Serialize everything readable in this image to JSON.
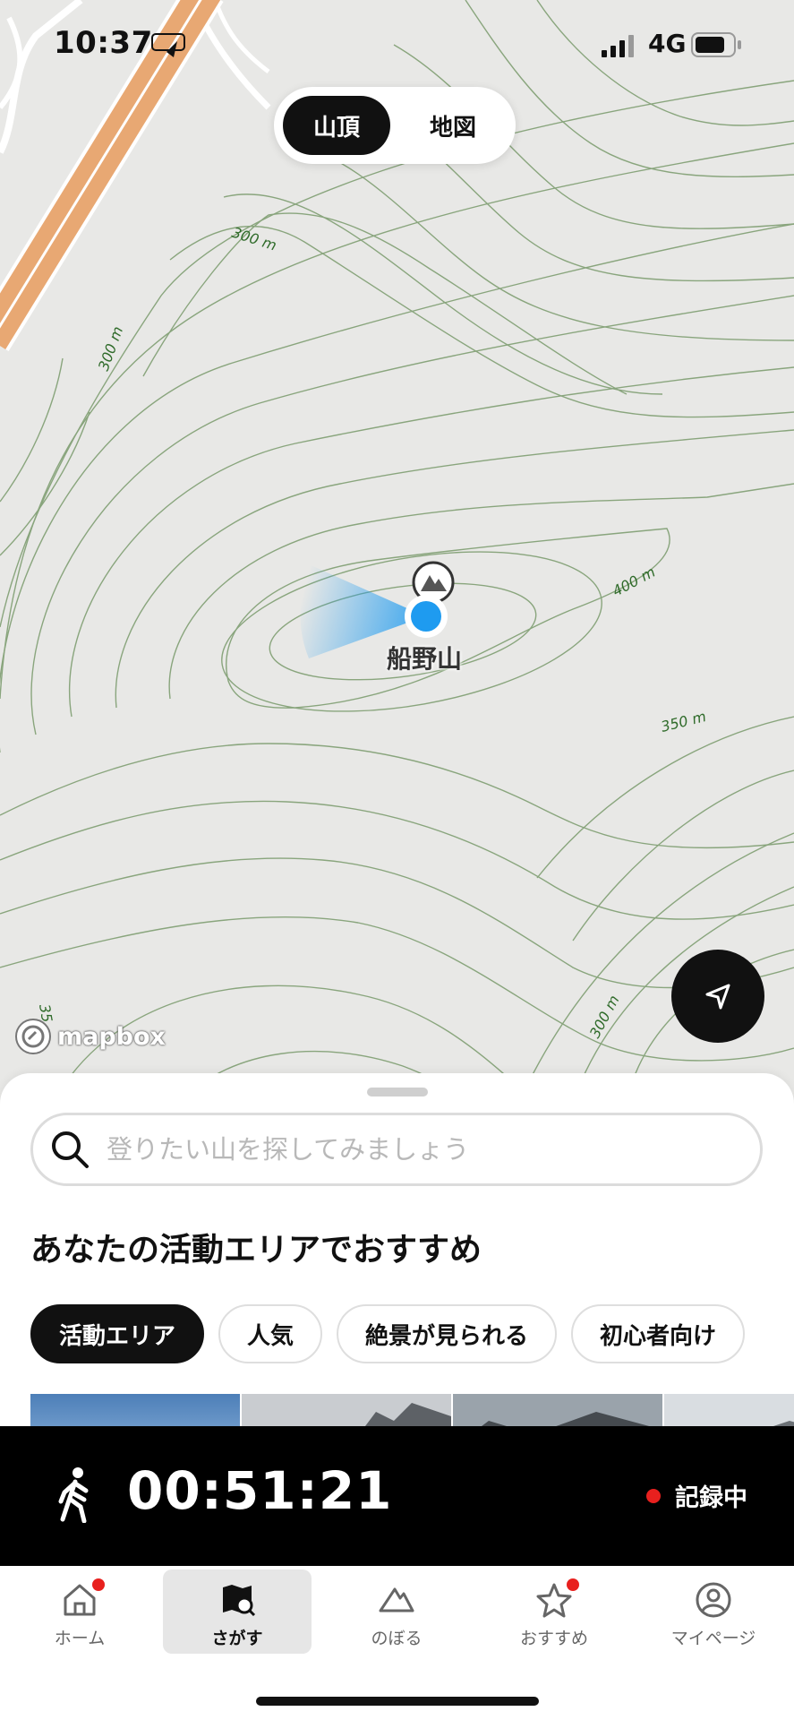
{
  "status_bar": {
    "time": "10:37",
    "network": "4G"
  },
  "map": {
    "segment": {
      "option_a": "山頂",
      "option_b": "地図",
      "selected": "山頂"
    },
    "contour_labels": [
      "300 m",
      "300 m",
      "400 m",
      "350 m",
      "300 m",
      "35"
    ],
    "mountain_name": "船野山",
    "attribution": "mapbox"
  },
  "sheet": {
    "search_placeholder": "登りたい山を探してみましょう",
    "section_title": "あなたの活動エリアでおすすめ",
    "chips": [
      "活動エリア",
      "人気",
      "絶景が見られる",
      "初心者向け"
    ],
    "active_chip": "活動エリア"
  },
  "recording": {
    "elapsed": "00:51:21",
    "status": "記録中"
  },
  "tabs": [
    {
      "label": "ホーム",
      "icon": "home-icon",
      "badge": true
    },
    {
      "label": "さがす",
      "icon": "map-search-icon",
      "badge": false
    },
    {
      "label": "のぼる",
      "icon": "mountain-icon",
      "badge": false
    },
    {
      "label": "おすすめ",
      "icon": "star-icon",
      "badge": true
    },
    {
      "label": "マイページ",
      "icon": "profile-icon",
      "badge": false
    }
  ],
  "active_tab": "さがす",
  "colors": {
    "road": "#e8a873",
    "contour": "#5e9a4a",
    "location": "#1e9bf0",
    "record_dot": "#e8201e"
  }
}
